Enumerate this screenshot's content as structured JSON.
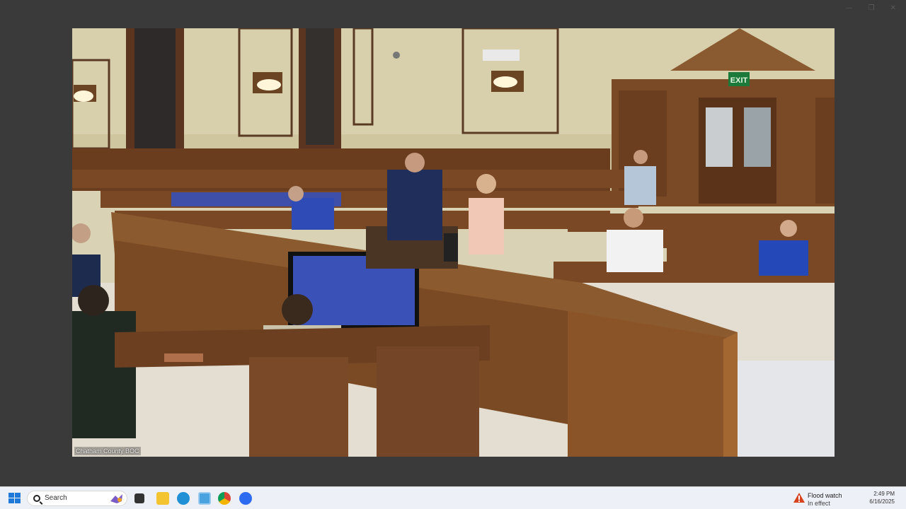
{
  "video": {
    "source_label": "Chatham County BOC",
    "exit_sign": "EXIT"
  },
  "taskbar": {
    "start_icon": "windows-start-icon",
    "search": {
      "placeholder": "Search"
    },
    "pinned": [
      {
        "name": "task-view-icon",
        "color": "#222222"
      },
      {
        "name": "file-explorer-icon",
        "color": "#f4c430"
      },
      {
        "name": "edge-icon",
        "color": "#1f8fd6"
      },
      {
        "name": "screen-capture-icon",
        "color": "#4aa3df"
      },
      {
        "name": "chrome-icon",
        "color": "#db4437"
      },
      {
        "name": "zoom-icon",
        "color": "#2d6cf0"
      }
    ],
    "weather": {
      "title": "Flood watch",
      "status": "In effect"
    },
    "clock": {
      "time": "2:49 PM",
      "date": "6/16/2025"
    }
  }
}
